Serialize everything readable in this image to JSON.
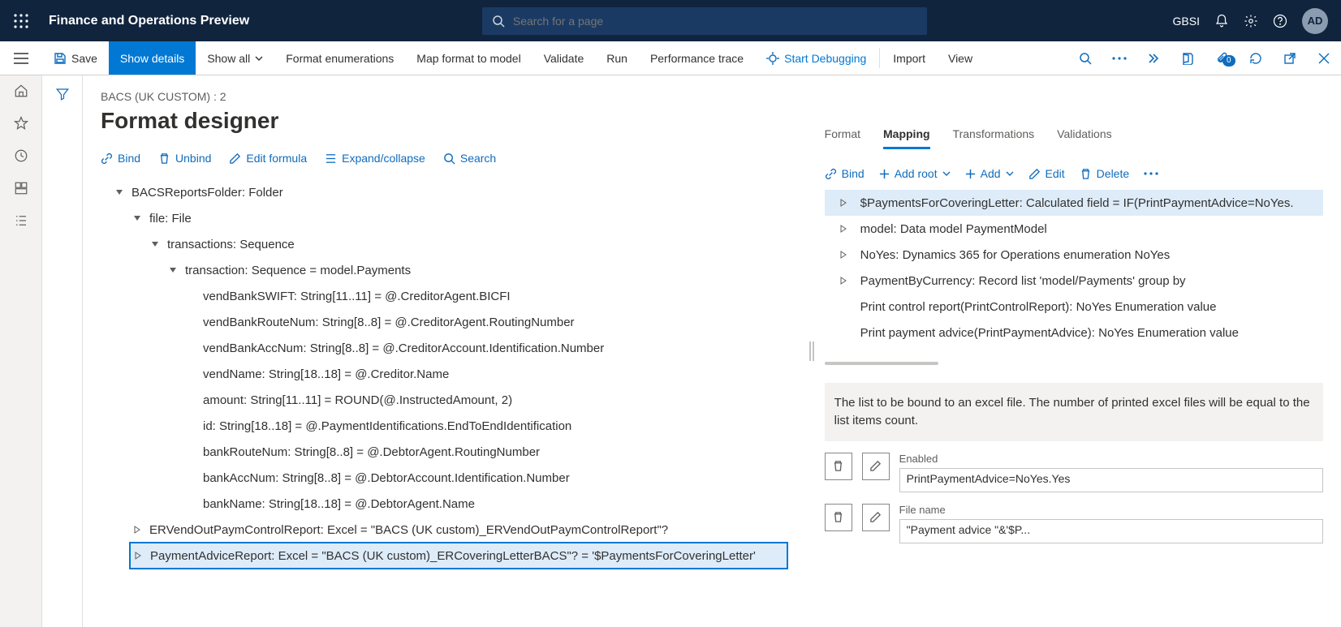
{
  "header": {
    "app_title": "Finance and Operations Preview",
    "search_placeholder": "Search for a page",
    "org": "GBSI",
    "avatar_initials": "AD"
  },
  "commands": {
    "save": "Save",
    "show_details": "Show details",
    "show_all": "Show all",
    "format_enum": "Format enumerations",
    "map_format": "Map format to model",
    "validate": "Validate",
    "run": "Run",
    "perf_trace": "Performance trace",
    "start_debug": "Start Debugging",
    "import": "Import",
    "view": "View",
    "notif_badge": "0"
  },
  "page": {
    "breadcrumb": "BACS (UK CUSTOM) : 2",
    "title": "Format designer"
  },
  "toolbar": {
    "bind": "Bind",
    "unbind": "Unbind",
    "edit_formula": "Edit formula",
    "expand_collapse": "Expand/collapse",
    "search": "Search"
  },
  "format_tree": [
    {
      "indent": 0,
      "exp": "down",
      "label": "BACSReportsFolder: Folder"
    },
    {
      "indent": 1,
      "exp": "down",
      "label": "file: File"
    },
    {
      "indent": 2,
      "exp": "down",
      "label": "transactions: Sequence"
    },
    {
      "indent": 3,
      "exp": "down",
      "label": "transaction: Sequence = model.Payments"
    },
    {
      "indent": 4,
      "exp": "none",
      "label": "vendBankSWIFT: String[11..11] = @.CreditorAgent.BICFI"
    },
    {
      "indent": 4,
      "exp": "none",
      "label": "vendBankRouteNum: String[8..8] = @.CreditorAgent.RoutingNumber"
    },
    {
      "indent": 4,
      "exp": "none",
      "label": "vendBankAccNum: String[8..8] = @.CreditorAccount.Identification.Number"
    },
    {
      "indent": 4,
      "exp": "none",
      "label": "vendName: String[18..18] = @.Creditor.Name"
    },
    {
      "indent": 4,
      "exp": "none",
      "label": "amount: String[11..11] = ROUND(@.InstructedAmount, 2)"
    },
    {
      "indent": 4,
      "exp": "none",
      "label": "id: String[18..18] = @.PaymentIdentifications.EndToEndIdentification"
    },
    {
      "indent": 4,
      "exp": "none",
      "label": "bankRouteNum: String[8..8] = @.DebtorAgent.RoutingNumber"
    },
    {
      "indent": 4,
      "exp": "none",
      "label": "bankAccNum: String[8..8] = @.DebtorAccount.Identification.Number"
    },
    {
      "indent": 4,
      "exp": "none",
      "label": "bankName: String[18..18] = @.DebtorAgent.Name"
    },
    {
      "indent": 1,
      "exp": "right",
      "label": "ERVendOutPaymControlReport: Excel = \"BACS (UK custom)_ERVendOutPaymControlReport\"?"
    },
    {
      "indent": 1,
      "exp": "right",
      "label": "PaymentAdviceReport: Excel = \"BACS (UK custom)_ERCoveringLetterBACS\"? = '$PaymentsForCoveringLetter'",
      "selected": true
    }
  ],
  "tabs": {
    "format": "Format",
    "mapping": "Mapping",
    "transformations": "Transformations",
    "validations": "Validations"
  },
  "map_toolbar": {
    "bind": "Bind",
    "add_root": "Add root",
    "add": "Add",
    "edit": "Edit",
    "delete": "Delete"
  },
  "mapping_tree": [
    {
      "exp": "right",
      "label": "$PaymentsForCoveringLetter: Calculated field = IF(PrintPaymentAdvice=NoYes.",
      "selected": true
    },
    {
      "exp": "right",
      "label": "model: Data model PaymentModel"
    },
    {
      "exp": "right",
      "label": "NoYes: Dynamics 365 for Operations enumeration NoYes"
    },
    {
      "exp": "right",
      "label": "PaymentByCurrency: Record list 'model/Payments' group by"
    },
    {
      "exp": "none",
      "label": "Print control report(PrintControlReport): NoYes Enumeration value"
    },
    {
      "exp": "none",
      "label": "Print payment advice(PrintPaymentAdvice): NoYes Enumeration value"
    }
  ],
  "help_text": "The list to be bound to an excel file. The number of printed excel files will be equal to the list items count.",
  "properties": {
    "enabled_label": "Enabled",
    "enabled_value": "PrintPaymentAdvice=NoYes.Yes",
    "filename_label": "File name",
    "filename_value": "\"Payment advice \"&'$P..."
  }
}
